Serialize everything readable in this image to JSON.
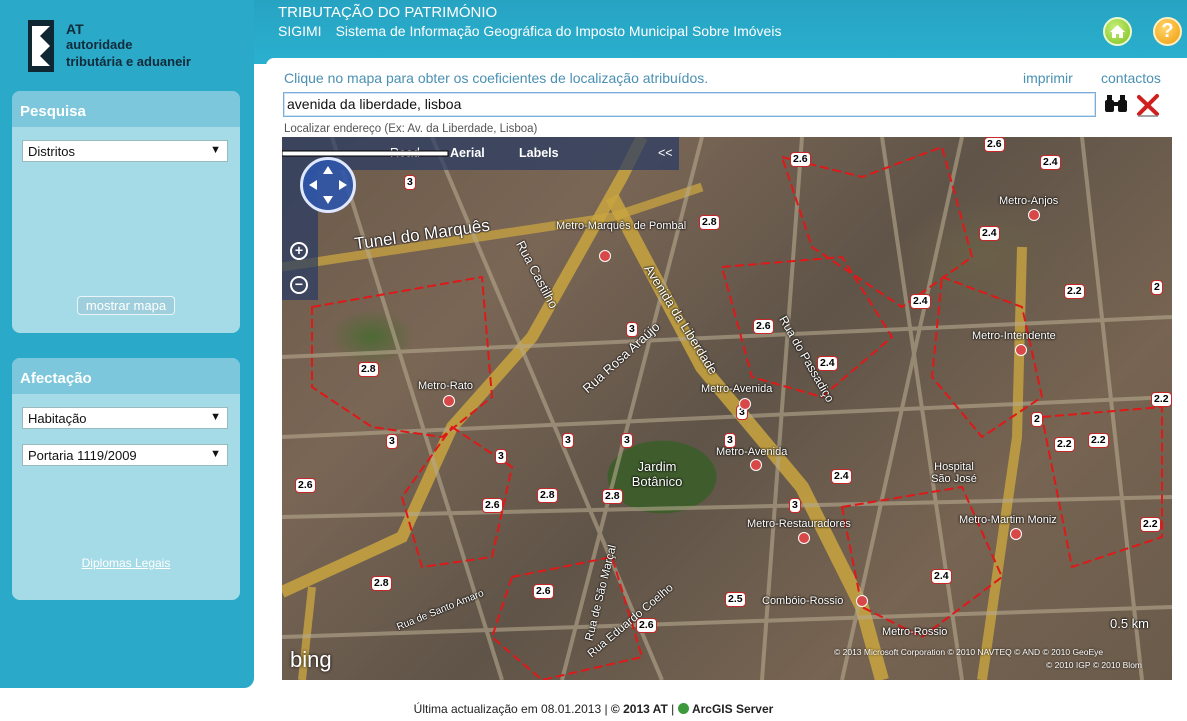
{
  "brand": {
    "line1": "AT",
    "line2": "autoridade",
    "line3": "tributária e aduaneir"
  },
  "header": {
    "title": "TRIBUTAÇÃO DO PATRIMÓNIO",
    "acronym": "SIGIMI",
    "subtitle": "Sistema de Informação Geográfica do Imposto Municipal Sobre Imóveis"
  },
  "sidebar": {
    "pesquisa": {
      "title": "Pesquisa",
      "select_value": "Distritos",
      "button_label": "mostrar mapa"
    },
    "afectacao": {
      "title": "Afectação",
      "select1_value": "Habitação",
      "select2_value": "Portaria 1119/2009",
      "link_label": "Diplomas Legais"
    }
  },
  "toolbar": {
    "hint": "Clique no mapa para obter os coeficientes de localização atribuídos.",
    "print_label": "imprimir",
    "contacts_label": "contactos",
    "search_value": "avenida da liberdade, lisboa",
    "search_hint": "Localizar endereço (Ex: Av. da Liberdade, Lisboa)"
  },
  "map": {
    "nav": {
      "road": "Road",
      "aerial": "Aerial",
      "labels": "Labels",
      "collapse": "<<"
    },
    "zone_labels": [
      "2.6",
      "2.8",
      "3",
      "2.4",
      "2.2",
      "2",
      "2.5"
    ],
    "places": {
      "marques": "Metro-Marquês de Pombal",
      "anjos": "Metro-Anjos",
      "intendente": "Metro-Intendente",
      "rato": "Metro-Rato",
      "avenida1": "Metro-Avenida",
      "avenida2": "Metro-Avenida",
      "restauradores": "Metro-Restauradores",
      "martim": "Metro-Martim Moniz",
      "rossio": "Metro-Rossio",
      "combo_rossio": "Combóio-Rossio",
      "jardim": "Jardim Botânico",
      "hospital": "Hospital São José"
    },
    "streets": {
      "tunel": "Tunel do Marquês",
      "castilho": "Rua Castilho",
      "liberdade": "Avenida da Liberdade",
      "rosa_araujo": "Rua Rosa Araújo",
      "passadiço": "Rua do Passadiço",
      "santo_amaro": "Rua de Santo Amaro",
      "sao_marcal": "Rua de São Marçal",
      "eduardo_coelho": "Rua Eduardo Coelho"
    },
    "scale": "0.5 km",
    "copyright1": "© 2013 Microsoft Corporation   © 2010 NAVTEQ   © AND   © 2010 GeoEye",
    "copyright2": "© 2010 IGP  © 2010 Blom",
    "bing": "bing"
  },
  "footer": {
    "text": "Última actualização em 08.01.2013 |",
    "copy": "© 2013 AT",
    "arcgis": "ArcGIS Server"
  }
}
